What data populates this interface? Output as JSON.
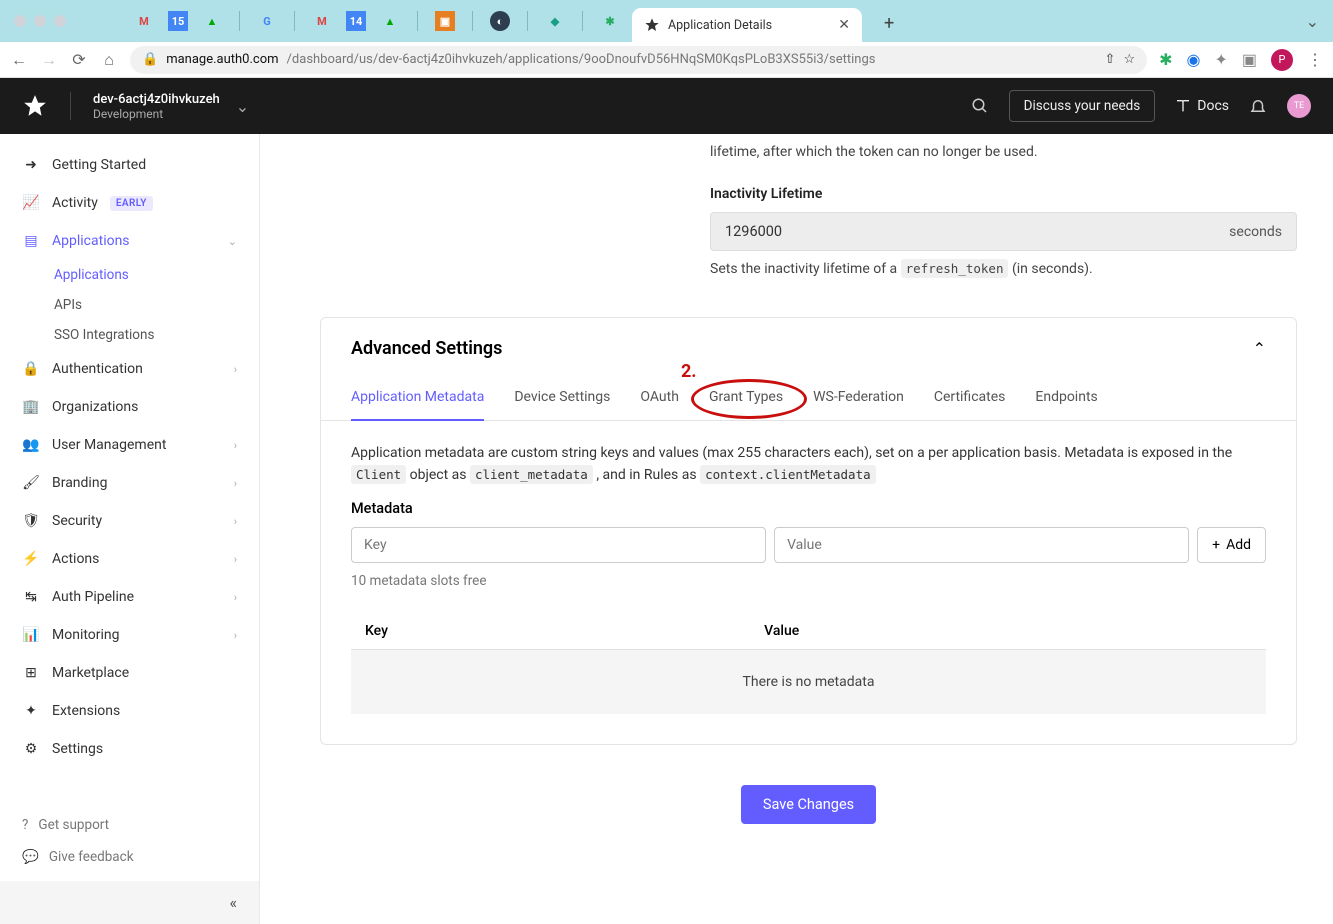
{
  "browser": {
    "tab_title": "Application Details",
    "url_domain": "manage.auth0.com",
    "url_path": "/dashboard/us/dev-6actj4z0ihvkuzeh/applications/9ooDnoufvD56HNqSM0KqsPLoB3XS55i3/settings",
    "avatar_letter": "P"
  },
  "header": {
    "tenant_name": "dev-6actj4z0ihvkuzeh",
    "tenant_env": "Development",
    "discuss_label": "Discuss your needs",
    "docs_label": "Docs",
    "avatar_text": "TE"
  },
  "sidebar": {
    "getting_started": "Getting Started",
    "activity": "Activity",
    "activity_badge": "EARLY",
    "applications": "Applications",
    "sub_applications": "Applications",
    "sub_apis": "APIs",
    "sub_sso": "SSO Integrations",
    "authentication": "Authentication",
    "organizations": "Organizations",
    "user_management": "User Management",
    "branding": "Branding",
    "security": "Security",
    "actions": "Actions",
    "auth_pipeline": "Auth Pipeline",
    "monitoring": "Monitoring",
    "marketplace": "Marketplace",
    "extensions": "Extensions",
    "settings": "Settings",
    "get_support": "Get support",
    "give_feedback": "Give feedback"
  },
  "content": {
    "top_desc": "lifetime, after which the token can no longer be used.",
    "inactivity_label": "Inactivity Lifetime",
    "inactivity_value": "1296000",
    "inactivity_unit": "seconds",
    "inactivity_help_pre": "Sets the inactivity lifetime of a ",
    "inactivity_help_code": "refresh_token",
    "inactivity_help_post": " (in seconds).",
    "panel_title": "Advanced Settings",
    "tabs": {
      "app_metadata": "Application Metadata",
      "device_settings": "Device Settings",
      "oauth": "OAuth",
      "grant_types": "Grant Types",
      "ws_federation": "WS-Federation",
      "certificates": "Certificates",
      "endpoints": "Endpoints"
    },
    "annotation": "2.",
    "meta_desc_1": "Application metadata are custom string keys and values (max 255 characters each), set on a per application basis. Metadata is exposed in the ",
    "meta_code_1": "Client",
    "meta_desc_2": " object as ",
    "meta_code_2": "client_metadata",
    "meta_desc_3": " , and in Rules as ",
    "meta_code_3": "context.clientMetadata",
    "meta_label": "Metadata",
    "key_placeholder": "Key",
    "value_placeholder": "Value",
    "add_label": "Add",
    "slots_free": "10 metadata slots free",
    "col_key": "Key",
    "col_value": "Value",
    "empty_text": "There is no metadata",
    "save_label": "Save Changes"
  }
}
